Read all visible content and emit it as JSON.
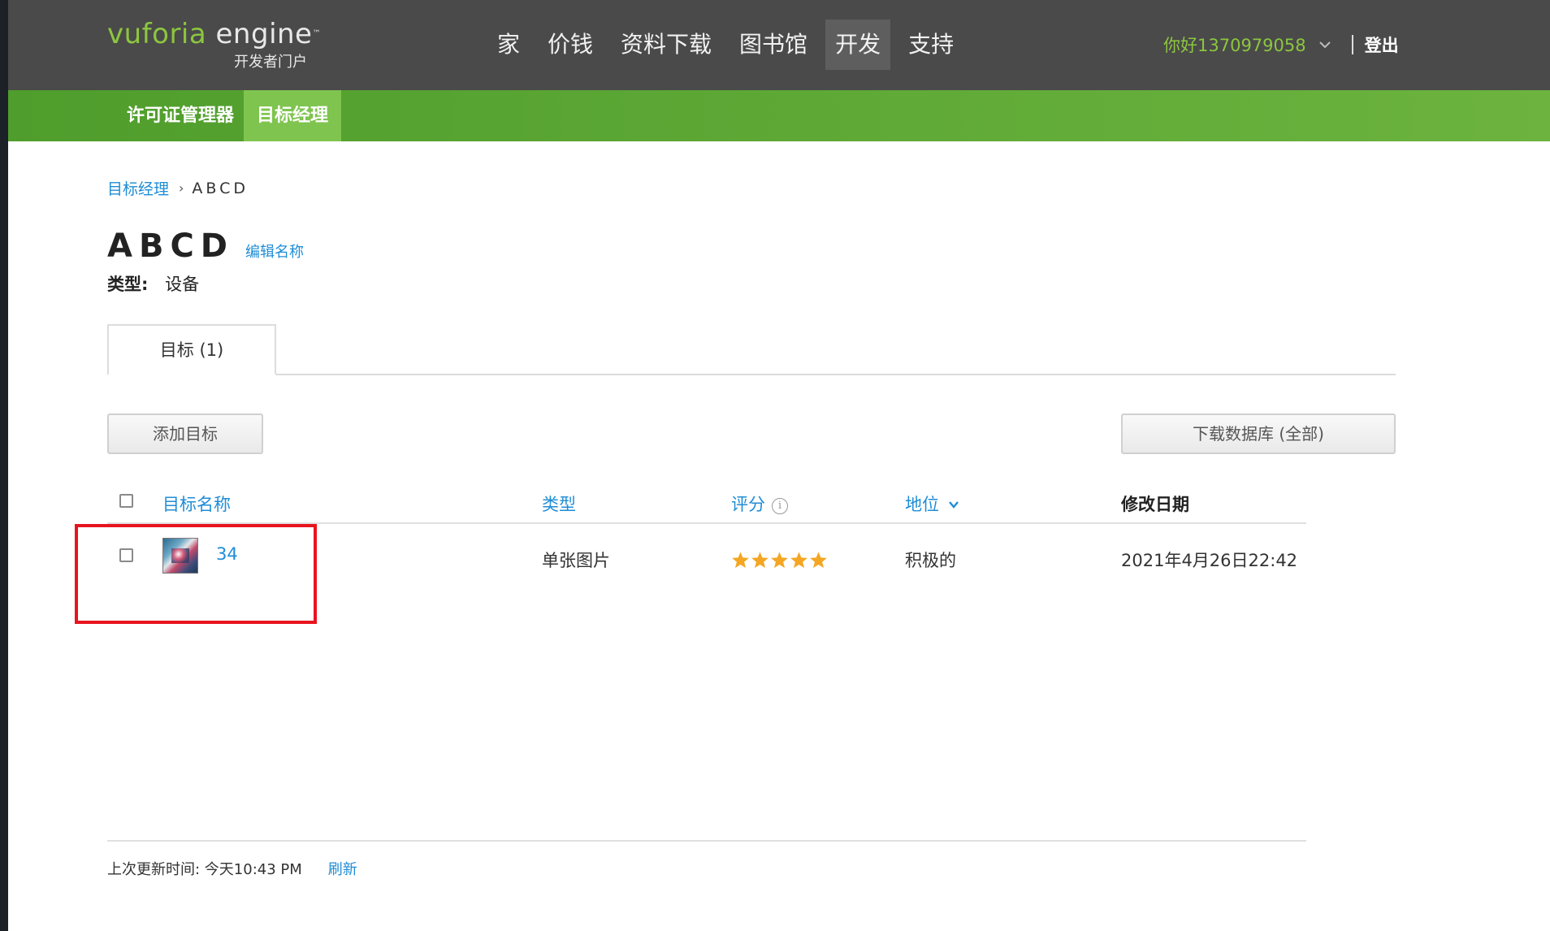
{
  "header": {
    "logo_brand": "vuforia",
    "logo_engine": "engine",
    "logo_tm": "™",
    "logo_sub": "开发者门户",
    "nav": [
      {
        "label": "家"
      },
      {
        "label": "价钱"
      },
      {
        "label": "资料下载"
      },
      {
        "label": "图书馆"
      },
      {
        "label": "开发",
        "active": true
      },
      {
        "label": "支持"
      }
    ],
    "greeting": "你好1370979058",
    "logout": "登出"
  },
  "subnav": {
    "items": [
      {
        "label": "许可证管理器"
      },
      {
        "label": "目标经理",
        "active": true
      }
    ]
  },
  "breadcrumb": {
    "link": "目标经理",
    "separator": "›",
    "current": "ABCD"
  },
  "database": {
    "title": "ABCD",
    "edit_label": "编辑名称",
    "type_label": "类型:",
    "type_value": "设备"
  },
  "tabs": [
    {
      "label": "目标 (1)"
    }
  ],
  "actions": {
    "add_target": "添加目标",
    "download": "下载数据库 (全部)"
  },
  "table": {
    "headers": {
      "name": "目标名称",
      "type": "类型",
      "rating": "评分",
      "status": "地位",
      "modified": "修改日期"
    },
    "rows": [
      {
        "name": "34",
        "type": "单张图片",
        "rating": 5,
        "status": "积极的",
        "modified": "2021年4月26日22:42"
      }
    ]
  },
  "footer": {
    "updated": "上次更新时间: 今天10:43 PM",
    "refresh": "刷新"
  },
  "colors": {
    "accent_green": "#8cc63f",
    "link_blue": "#1f8dd6",
    "star_orange": "#f5a623",
    "highlight_red": "#e8141e",
    "nav_bg": "#4a4a4a"
  }
}
